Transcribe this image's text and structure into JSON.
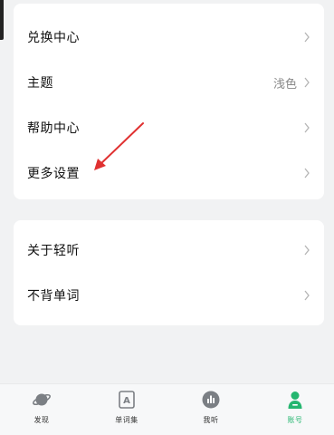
{
  "settings_card": {
    "items": [
      {
        "label": "兑换中心",
        "value": ""
      },
      {
        "label": "主题",
        "value": "浅色"
      },
      {
        "label": "帮助中心",
        "value": ""
      },
      {
        "label": "更多设置",
        "value": ""
      }
    ]
  },
  "about_card": {
    "items": [
      {
        "label": "关于轻听",
        "value": ""
      },
      {
        "label": "不背单词",
        "value": ""
      }
    ]
  },
  "annotation": {
    "color": "#e03131"
  },
  "bottom_nav": {
    "active_color": "#25b670",
    "items": [
      {
        "label": "发现",
        "icon": "planet-icon"
      },
      {
        "label": "单词集",
        "icon": "word-book-icon"
      },
      {
        "label": "我听",
        "icon": "audio-bars-icon"
      },
      {
        "label": "账号",
        "icon": "account-icon",
        "active": true
      }
    ]
  }
}
